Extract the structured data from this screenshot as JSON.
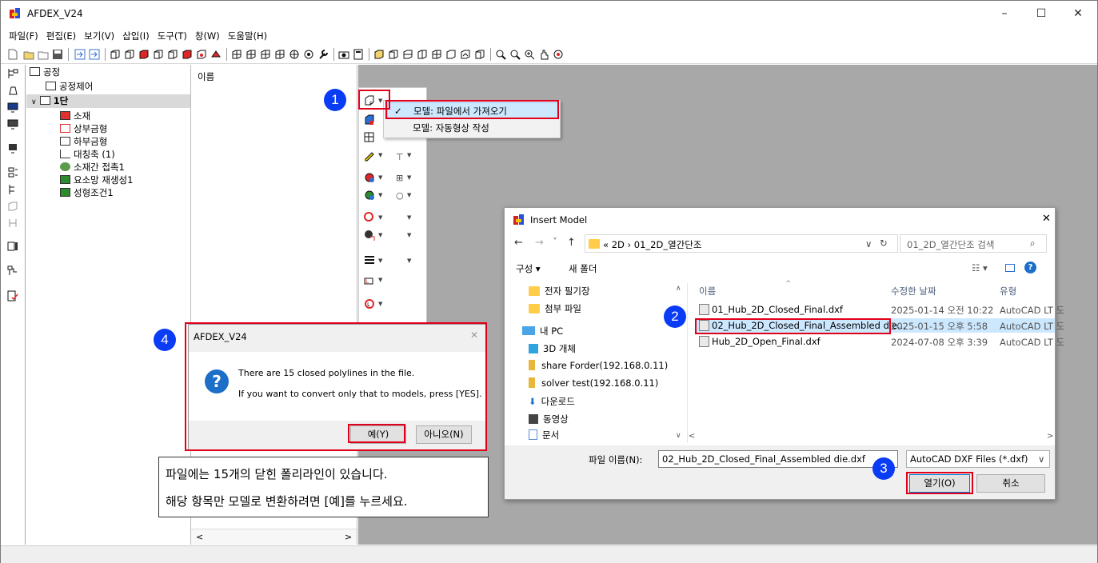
{
  "window": {
    "title": "AFDEX_V24",
    "controls": {
      "minimize": "–",
      "maximize": "☐",
      "close": "✕"
    }
  },
  "menu": [
    "파일(F)",
    "편집(E)",
    "보기(V)",
    "삽입(I)",
    "도구(T)",
    "창(W)",
    "도움말(H)"
  ],
  "tree": {
    "root": "공정",
    "item_process_control": "공정제어",
    "stage1": "1단",
    "children": [
      "소재",
      "상부금형",
      "하부금형",
      "대칭축 (1)",
      "소재간 접촉1",
      "요소망 재생성1",
      "성형조건1"
    ]
  },
  "name_panel": {
    "header": "이름",
    "scroll_left": "<",
    "scroll_right": ">"
  },
  "dropdown": {
    "items": [
      "모델: 파일에서 가져오기",
      "모델: 자동형상 작성"
    ],
    "checked": "✓"
  },
  "badges": [
    "1",
    "2",
    "3",
    "4"
  ],
  "insert_dialog": {
    "title": "Insert Model",
    "close": "✕",
    "nav": {
      "back": "←",
      "forward": "→",
      "recent": "˅",
      "up": "↑"
    },
    "address": "« 2D › 01_2D_열간단조",
    "search_placeholder": "01_2D_열간단조 검색",
    "organize": "구성 ▾",
    "new_folder": "새 폴더",
    "nav_items": [
      "전자 필기장",
      "첨부 파일",
      "내 PC",
      "3D 개체",
      "share Forder(192.168.0.11)",
      "solver test(192.168.0.11)",
      "다운로드",
      "동영상",
      "문서"
    ],
    "columns": {
      "name": "이름",
      "modified": "수정한 날짜",
      "type": "유형"
    },
    "files": [
      {
        "name": "01_Hub_2D_Closed_Final.dxf",
        "date": "2025-01-14 오전 10:22",
        "type": "AutoCAD LT 도"
      },
      {
        "name": "02_Hub_2D_Closed_Final_Assembled die...",
        "date": "2025-01-15 오후 5:58",
        "type": "AutoCAD LT 도"
      },
      {
        "name": "Hub_2D_Open_Final.dxf",
        "date": "2024-07-08 오후 3:39",
        "type": "AutoCAD LT 도"
      }
    ],
    "filename_label": "파일 이름(N):",
    "filename_value": "02_Hub_2D_Closed_Final_Assembled die.dxf",
    "filter": "AutoCAD DXF Files (*.dxf)",
    "open": "열기(O)",
    "cancel": "취소"
  },
  "message_box": {
    "title": "AFDEX_V24",
    "close": "✕",
    "line1": "There are 15 closed polylines in the file.",
    "line2": "If you want to convert only that to models, press [YES].",
    "yes": "예(Y)",
    "no": "아니오(N)"
  },
  "note": {
    "line1": "파일에는 15개의 닫힌 폴리라인이 있습니다.",
    "line2": "해당 항목만 모델로 변환하려면 [예]를 누르세요."
  },
  "colors": {
    "highlight": "#cce8ff",
    "red_box": "#e0001b",
    "badge": "#0a3cf5",
    "workspace": "#a8a8a8"
  }
}
